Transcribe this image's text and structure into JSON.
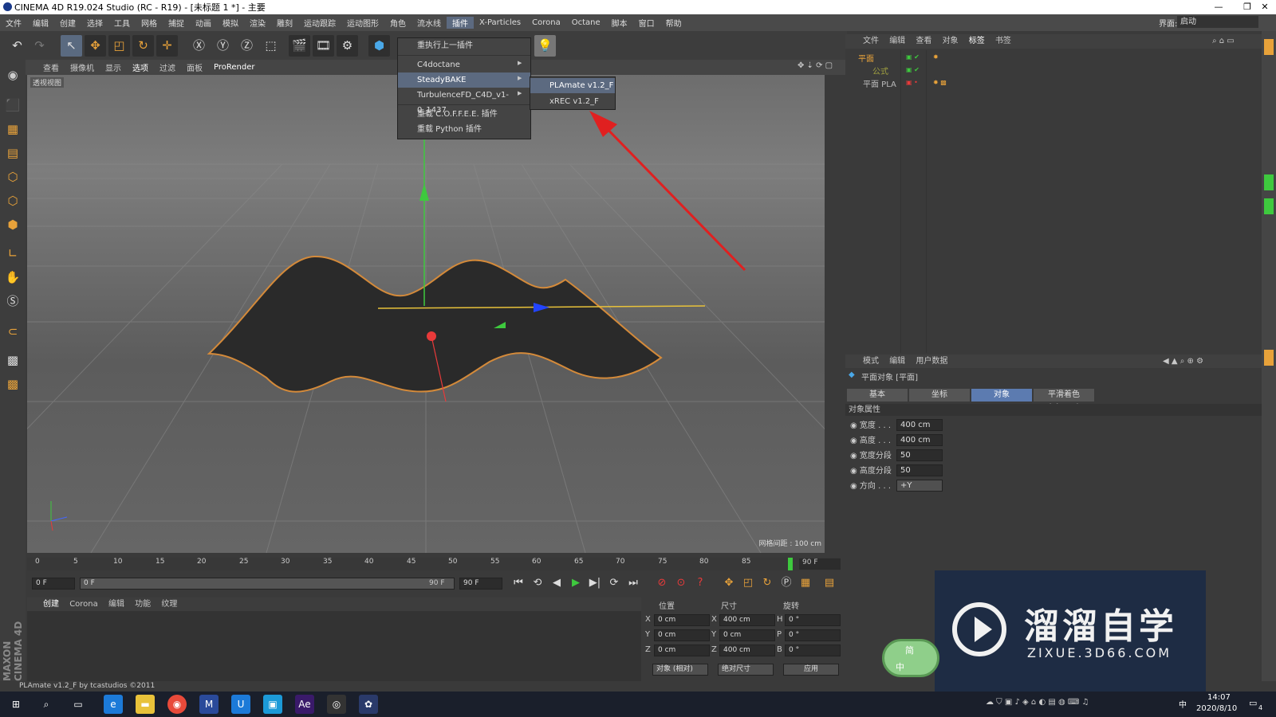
{
  "window": {
    "title": "CINEMA 4D R19.024 Studio (RC - R19) - [未标题 1 *] - 主要",
    "min": "—",
    "max": "❐",
    "close": "✕"
  },
  "menubar": {
    "items": [
      "文件",
      "编辑",
      "创建",
      "选择",
      "工具",
      "网格",
      "捕捉",
      "动画",
      "模拟",
      "渲染",
      "雕刻",
      "运动跟踪",
      "运动图形",
      "角色",
      "流水线",
      "插件",
      "X-Particles",
      "Corona",
      "Octane",
      "脚本",
      "窗口",
      "帮助"
    ],
    "active": "插件",
    "layout_label": "界面:",
    "layout_value": "启动"
  },
  "plugin_menu": {
    "items": [
      "重执行上一插件",
      "C4doctane",
      "SteadyBAKE",
      "TurbulenceFD_C4D_v1-0_1437",
      "重载 C.O.F.F.E.E. 插件",
      "重载 Python 插件"
    ],
    "highlighted": "SteadyBAKE"
  },
  "submenu": {
    "items": [
      "PLAmate v1.2_F",
      "xREC v1.2_F"
    ]
  },
  "viewport": {
    "menu": [
      "查看",
      "摄像机",
      "显示",
      "选项",
      "过滤",
      "面板",
      "ProRender"
    ],
    "label": "透视视图",
    "grid_info": "网格间距 : 100 cm"
  },
  "timeline": {
    "ticks": [
      "0",
      "5",
      "10",
      "15",
      "20",
      "25",
      "30",
      "35",
      "40",
      "45",
      "50",
      "55",
      "60",
      "65",
      "70",
      "75",
      "80",
      "85"
    ],
    "end_frame": "90 F",
    "current": "0 F",
    "range_start": "0 F",
    "range_end": "90 F",
    "range_total": "90 F"
  },
  "material_panel": {
    "tabs": [
      "创建",
      "Corona",
      "编辑",
      "功能",
      "纹理"
    ]
  },
  "coords": {
    "headers": [
      "位置",
      "尺寸",
      "旋转"
    ],
    "rows": [
      {
        "axis": "X",
        "pos": "0 cm",
        "saxis": "X",
        "size": "400 cm",
        "raxis": "H",
        "rot": "0 °"
      },
      {
        "axis": "Y",
        "pos": "0 cm",
        "saxis": "Y",
        "size": "0 cm",
        "raxis": "P",
        "rot": "0 °"
      },
      {
        "axis": "Z",
        "pos": "0 cm",
        "saxis": "Z",
        "size": "400 cm",
        "raxis": "B",
        "rot": "0 °"
      }
    ],
    "mode": "对象 (相对)",
    "size_mode": "绝对尺寸",
    "apply": "应用"
  },
  "object_manager": {
    "menu": [
      "文件",
      "编辑",
      "查看",
      "对象",
      "标签",
      "书签"
    ],
    "objects": [
      "平面",
      "公式",
      "平面 PLA"
    ]
  },
  "attr_manager": {
    "menu": [
      "模式",
      "编辑",
      "用户数据"
    ],
    "object_title": "平面对象 [平面]",
    "tabs": [
      "基本",
      "坐标",
      "对象",
      "平滑着色(Phong)"
    ],
    "active_tab": "对象",
    "section": "对象属性",
    "props": [
      {
        "label": "宽度 . . .",
        "value": "400 cm"
      },
      {
        "label": "高度 . . .",
        "value": "400 cm"
      },
      {
        "label": "宽度分段",
        "value": "50"
      },
      {
        "label": "高度分段",
        "value": "50"
      },
      {
        "label": "方向 . . .",
        "value": "+Y"
      }
    ]
  },
  "status": {
    "text": "PLAmate v1.2_F by tcastudios ©2011"
  },
  "brand": {
    "side": "MAXON CINEMA 4D"
  },
  "taskbar": {
    "time": "14:07",
    "date": "2020/8/10",
    "ime": "中",
    "badge": "4",
    "tray_ime": "简",
    "tray_lang": "中"
  },
  "watermark": {
    "title": "溜溜自学",
    "url": "ZIXUE.3D66.COM"
  }
}
